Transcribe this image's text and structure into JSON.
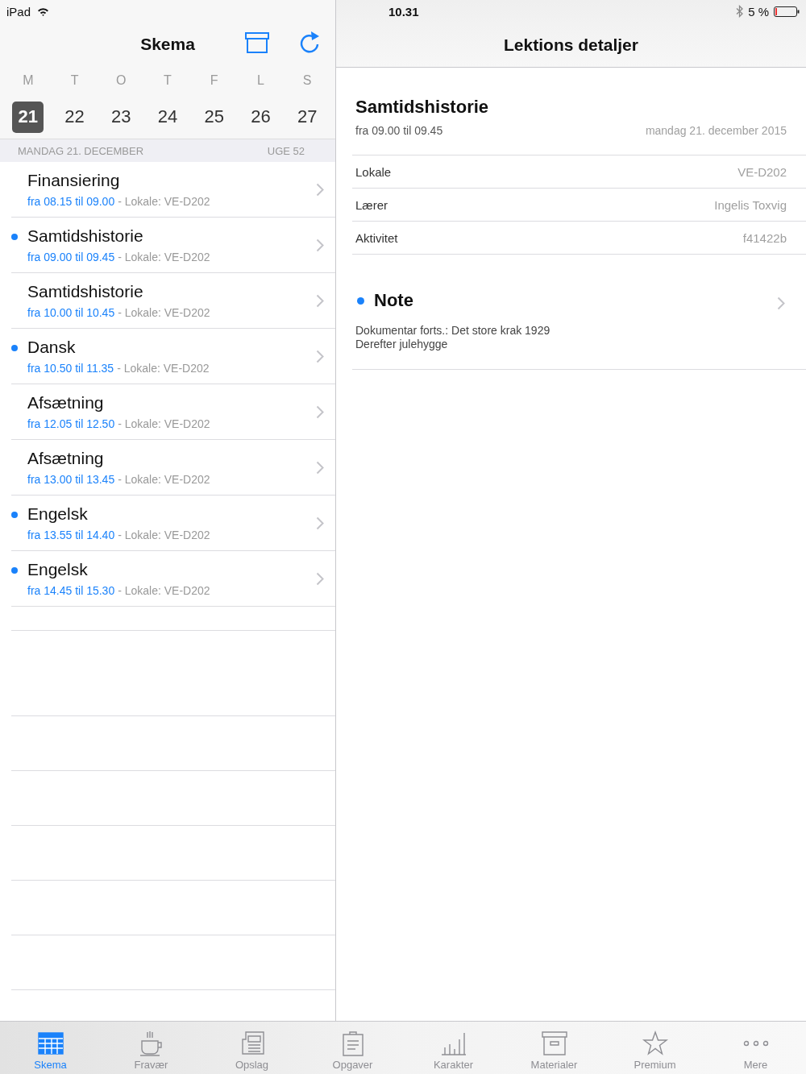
{
  "status_bar": {
    "device": "iPad",
    "time": "10.31",
    "battery": "5 %"
  },
  "schedule": {
    "title": "Skema",
    "weekdays": [
      "M",
      "T",
      "O",
      "T",
      "F",
      "L",
      "S"
    ],
    "days": [
      {
        "label": "21",
        "selected": true
      },
      {
        "label": "22",
        "selected": false
      },
      {
        "label": "23",
        "selected": false
      },
      {
        "label": "24",
        "selected": false
      },
      {
        "label": "25",
        "selected": false
      },
      {
        "label": "26",
        "selected": false
      },
      {
        "label": "27",
        "selected": false
      }
    ],
    "date_header": "MANDAG 21. DECEMBER",
    "week": "UGE 52",
    "lessons": [
      {
        "title": "Finansiering",
        "time": "fra 08.15 til 09.00",
        "room": "- Lokale: VE-D202",
        "has_note": false
      },
      {
        "title": "Samtidshistorie",
        "time": "fra 09.00 til 09.45",
        "room": "- Lokale: VE-D202",
        "has_note": true
      },
      {
        "title": "Samtidshistorie",
        "time": "fra 10.00 til 10.45",
        "room": "- Lokale: VE-D202",
        "has_note": false
      },
      {
        "title": "Dansk",
        "time": "fra 10.50 til 11.35",
        "room": "- Lokale: VE-D202",
        "has_note": true
      },
      {
        "title": "Afsætning",
        "time": "fra 12.05 til 12.50",
        "room": "- Lokale: VE-D202",
        "has_note": false
      },
      {
        "title": "Afsætning",
        "time": "fra 13.00 til 13.45",
        "room": "- Lokale: VE-D202",
        "has_note": false
      },
      {
        "title": "Engelsk",
        "time": "fra 13.55 til 14.40",
        "room": "- Lokale: VE-D202",
        "has_note": true
      },
      {
        "title": "Engelsk",
        "time": "fra 14.45 til 15.30",
        "room": "- Lokale: VE-D202",
        "has_note": true
      }
    ]
  },
  "details": {
    "title": "Lektions detaljer",
    "lesson": "Samtidshistorie",
    "time": "fra 09.00 til 09.45",
    "date": "mandag 21. december 2015",
    "fields": [
      {
        "label": "Lokale",
        "value": "VE-D202"
      },
      {
        "label": "Lærer",
        "value": "Ingelis Toxvig"
      },
      {
        "label": "Aktivitet",
        "value": "f41422b"
      }
    ],
    "note": {
      "title": "Note",
      "lines": [
        "Dokumentar forts.: Det store krak 1929",
        "Derefter julehygge"
      ]
    }
  },
  "tab_bar": [
    {
      "label": "Skema",
      "kind": "table",
      "selected": true
    },
    {
      "label": "Fravær",
      "kind": "cup",
      "selected": false
    },
    {
      "label": "Opslag",
      "kind": "paper",
      "selected": false
    },
    {
      "label": "Opgaver",
      "kind": "clipboard",
      "selected": false
    },
    {
      "label": "Karakter",
      "kind": "bars",
      "selected": false
    },
    {
      "label": "Materialer",
      "kind": "box",
      "selected": false
    },
    {
      "label": "Premium",
      "kind": "star",
      "selected": false
    },
    {
      "label": "Mere",
      "kind": "dots",
      "selected": false
    }
  ]
}
